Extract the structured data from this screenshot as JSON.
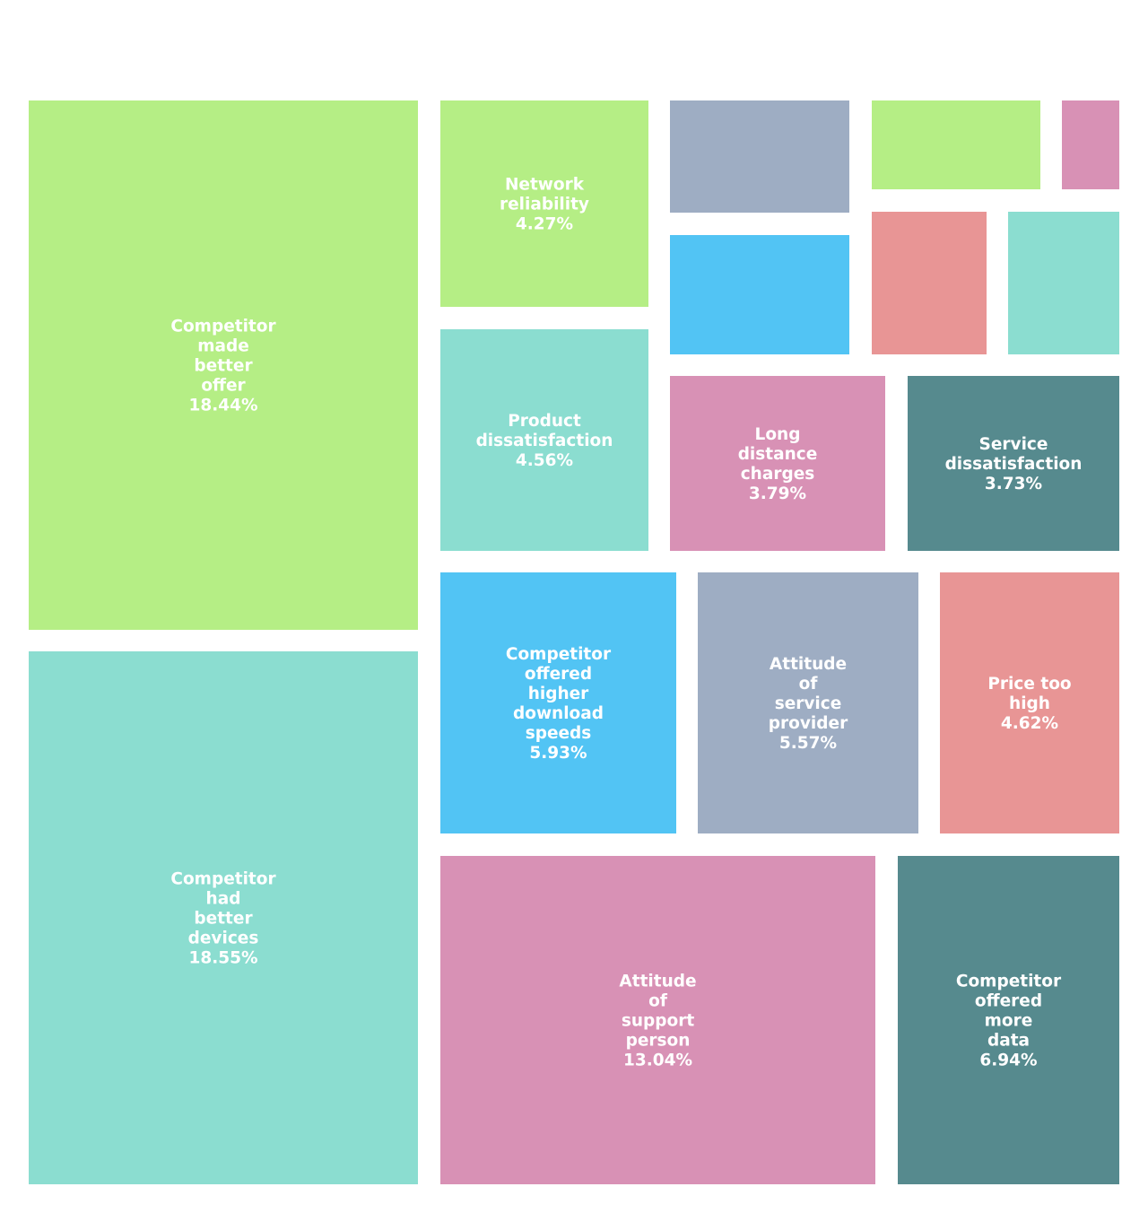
{
  "chart_data": {
    "type": "treemap",
    "title": "",
    "tiles": [
      {
        "label": "Competitor made better offer",
        "value": 18.44,
        "value_text": "18.44%",
        "color": "#b5ee85",
        "show_label": true
      },
      {
        "label": "Competitor had better devices",
        "value": 18.55,
        "value_text": "18.55%",
        "color": "#8bddd0",
        "show_label": true
      },
      {
        "label": "Network reliability",
        "value": 4.27,
        "value_text": "4.27%",
        "color": "#b5ee85",
        "show_label": true
      },
      {
        "label": "Product dissatisfaction",
        "value": 4.56,
        "value_text": "4.56%",
        "color": "#8bddd0",
        "show_label": true
      },
      {
        "label": "",
        "value": null,
        "value_text": "",
        "color": "#9eadc3",
        "show_label": false
      },
      {
        "label": "",
        "value": null,
        "value_text": "",
        "color": "#52c4f4",
        "show_label": false
      },
      {
        "label": "",
        "value": null,
        "value_text": "",
        "color": "#b5ee85",
        "show_label": false
      },
      {
        "label": "",
        "value": null,
        "value_text": "",
        "color": "#d891b5",
        "show_label": false
      },
      {
        "label": "",
        "value": null,
        "value_text": "",
        "color": "#e89595",
        "show_label": false
      },
      {
        "label": "",
        "value": null,
        "value_text": "",
        "color": "#8bddd0",
        "show_label": false
      },
      {
        "label": "Long distance charges",
        "value": 3.79,
        "value_text": "3.79%",
        "color": "#d891b5",
        "show_label": true
      },
      {
        "label": "Service dissatisfaction",
        "value": 3.73,
        "value_text": "3.73%",
        "color": "#568a8e",
        "show_label": true
      },
      {
        "label": "Competitor offered higher download speeds",
        "value": 5.93,
        "value_text": "5.93%",
        "color": "#52c4f4",
        "show_label": true
      },
      {
        "label": "Attitude of service provider",
        "value": 5.57,
        "value_text": "5.57%",
        "color": "#9eadc3",
        "show_label": true
      },
      {
        "label": "Price too high",
        "value": 4.62,
        "value_text": "4.62%",
        "color": "#e89595",
        "show_label": true
      },
      {
        "label": "Attitude of support person",
        "value": 13.04,
        "value_text": "13.04%",
        "color": "#d891b5",
        "show_label": true
      },
      {
        "label": "Competitor offered more data",
        "value": 6.94,
        "value_text": "6.94%",
        "color": "#568a8e",
        "show_label": true
      }
    ]
  }
}
